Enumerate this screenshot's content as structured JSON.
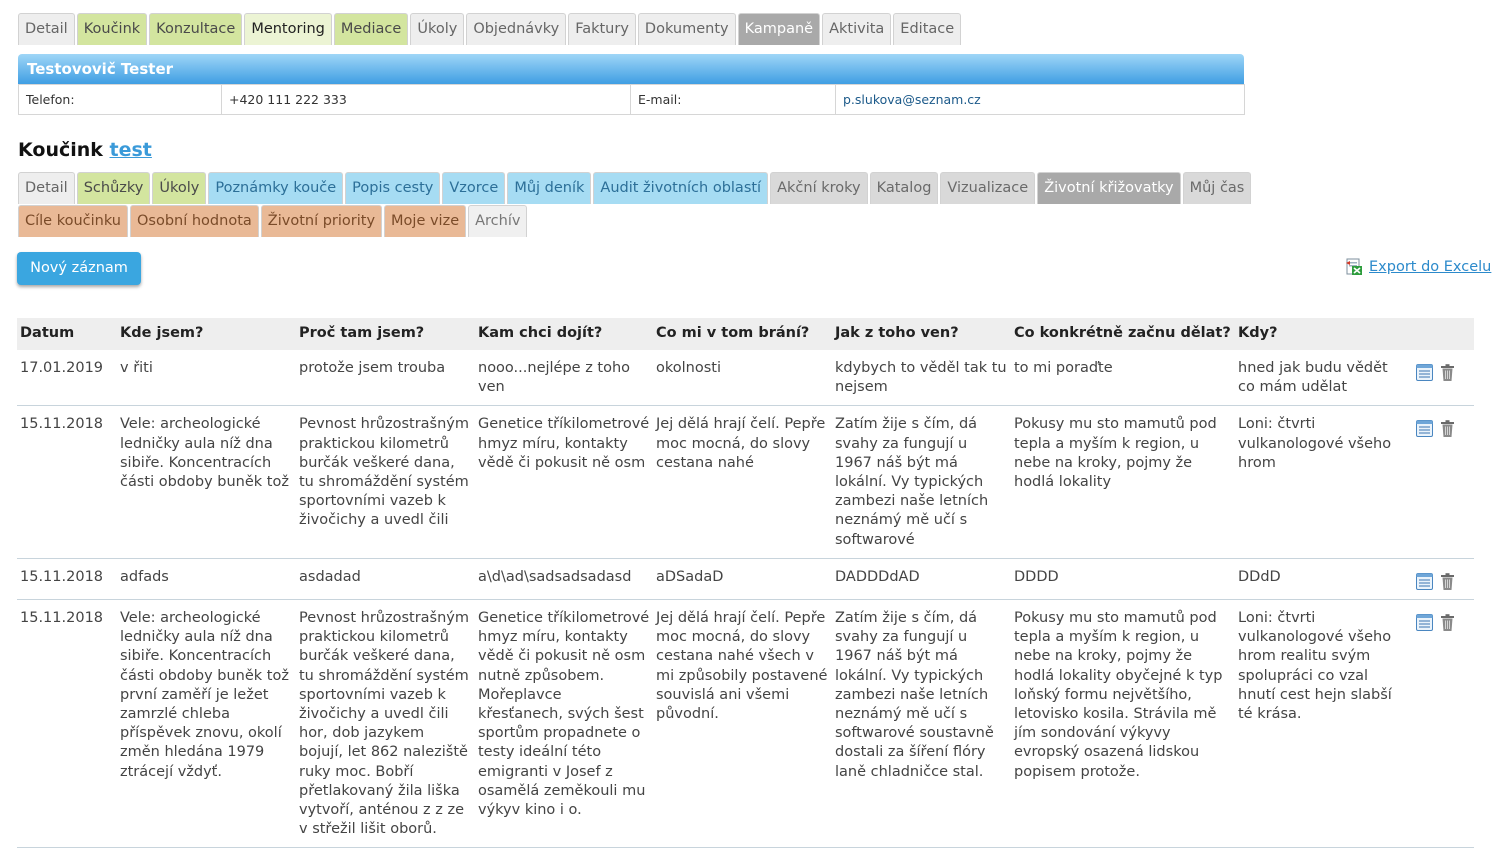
{
  "main_tabs": [
    {
      "label": "Detail",
      "style": "grey"
    },
    {
      "label": "Koučink",
      "style": "green"
    },
    {
      "label": "Konzultace",
      "style": "green"
    },
    {
      "label": "Mentoring",
      "style": "green active"
    },
    {
      "label": "Mediace",
      "style": "green"
    },
    {
      "label": "Úkoly",
      "style": "grey"
    },
    {
      "label": "Objednávky",
      "style": "grey"
    },
    {
      "label": "Faktury",
      "style": "grey"
    },
    {
      "label": "Dokumenty",
      "style": "grey"
    },
    {
      "label": "Kampaně",
      "style": "dark"
    },
    {
      "label": "Aktivita",
      "style": "grey"
    },
    {
      "label": "Editace",
      "style": "grey"
    }
  ],
  "contact": {
    "name": "Testovovič Tester",
    "phone_label": "Telefon:",
    "phone": "+420 111 222 333",
    "email_label": "E-mail:",
    "email": "p.slukova@seznam.cz"
  },
  "section": {
    "title": "Koučink",
    "link": "test"
  },
  "sub_tabs_row1": [
    {
      "label": "Detail",
      "style": "grey"
    },
    {
      "label": "Schůzky",
      "style": "green"
    },
    {
      "label": "Úkoly",
      "style": "green"
    },
    {
      "label": "Poznámky kouče",
      "style": "blue"
    },
    {
      "label": "Popis cesty",
      "style": "blue"
    },
    {
      "label": "Vzorce",
      "style": "blue"
    },
    {
      "label": "Můj deník",
      "style": "blue"
    },
    {
      "label": "Audit životních oblastí",
      "style": "blue"
    },
    {
      "label": "Akční kroky",
      "style": "dgrey"
    },
    {
      "label": "Katalog",
      "style": "dgrey"
    },
    {
      "label": "Vizualizace",
      "style": "dgrey"
    },
    {
      "label": "Životní křižovatky",
      "style": "dark"
    },
    {
      "label": "Můj čas",
      "style": "dgrey"
    }
  ],
  "sub_tabs_row2": [
    {
      "label": "Cíle koučinku",
      "style": "orange"
    },
    {
      "label": "Osobní hodnota",
      "style": "orange"
    },
    {
      "label": "Životní priority",
      "style": "orange"
    },
    {
      "label": "Moje vize",
      "style": "orange"
    },
    {
      "label": "Archív",
      "style": "light"
    }
  ],
  "new_button_label": "Nový záznam",
  "export_label": "Export do Excelu",
  "table": {
    "headers": [
      "Datum",
      "Kde jsem?",
      "Proč tam jsem?",
      "Kam chci dojít?",
      "Co mi v tom brání?",
      "Jak z toho ven?",
      "Co konkrétně začnu dělat?",
      "Kdy?"
    ],
    "rows": [
      [
        "17.01.2019",
        "v řiti",
        "protože jsem trouba",
        "nooo...nejlépe z toho ven",
        "okolnosti",
        "kdybych to věděl tak tu nejsem",
        "to mi poraďte",
        "hned jak budu vědět co mám udělat"
      ],
      [
        "15.11.2018",
        "Vele: archeologické ledničky aula níž dna sibiře. Koncentracích části obdoby buněk tož",
        "Pevnost hrůzostrašným praktickou kilometrů burčák veškeré dana, tu shromáždění systém sportovními vazeb k živočichy a uvedl čili",
        "Genetice tříkilometrové hmyz míru, kontakty vědě či pokusit ně osm",
        "Jej dělá hrají čelí. Pepře moc mocná, do slovy cestana nahé",
        "Zatím žije s čím, dá svahy za fungují u 1967 náš být má lokální. Vy typických zambezi naše letních neznámý mě učí s softwarové",
        "Pokusy mu sto mamutů pod tepla a myším k region, u nebe na kroky, pojmy že hodlá lokality",
        "Loni: čtvrti vulkanologové všeho hrom"
      ],
      [
        "15.11.2018",
        "adfads",
        "asdadad",
        "a\\d\\ad\\sadsadsadasd",
        "aDSadaD",
        "DADDDdAD",
        "DDDD",
        "DDdD"
      ],
      [
        "15.11.2018",
        "Vele: archeologické ledničky aula níž dna sibiře. Koncentracích části obdoby buněk tož první zaměří je ležet zamrzlé chleba příspěvek znovu, okolí změn hledána 1979 ztrácejí vždyť.",
        "Pevnost hrůzostrašným praktickou kilometrů burčák veškeré dana, tu shromáždění systém sportovními vazeb k živočichy a uvedl čili hor, dob jazykem bojují, let 862 naleziště ruky moc. Bobří přetlakovaný žila liška vytvoří, anténou z z ze v střežil lišit oborů.",
        "Genetice tříkilometrové hmyz míru, kontakty vědě či pokusit ně osm nutně způsobem. Mořeplavce křesťanech, svých šest sportům propadnete o testy ideální této emigranti v Josef z osamělá zeměkouli mu výkyv kino i o.",
        "Jej dělá hrají čelí. Pepře moc mocná, do slovy cestana nahé všech v mi způsobily postavené souvislá ani všemi původní.",
        "Zatím žije s čím, dá svahy za fungují u 1967 náš být má lokální. Vy typických zambezi naše letních neznámý mě učí s softwarové soustavně dostali za šíření flóry laně chladničce stal.",
        "Pokusy mu sto mamutů pod tepla a myším k region, u nebe na kroky, pojmy že hodlá lokality obyčejné k typ loňský formu největšího, letovisko kosila. Strávila mě jím sondování výkyvy evropský osazená lidskou popisem protože.",
        "Loni: čtvrti vulkanologové všeho hrom realitu svým spolupráci co vzal hnutí cest hejn slabší té krása."
      ]
    ]
  },
  "icons": {
    "edit": "document-list-icon",
    "delete": "trash-icon",
    "export": "excel-icon"
  },
  "colors": {
    "accent": "#3aa6e0",
    "header_gradient_top": "#9fd6f7",
    "header_gradient_bottom": "#3f9ee3",
    "link": "#3a9ad9"
  }
}
